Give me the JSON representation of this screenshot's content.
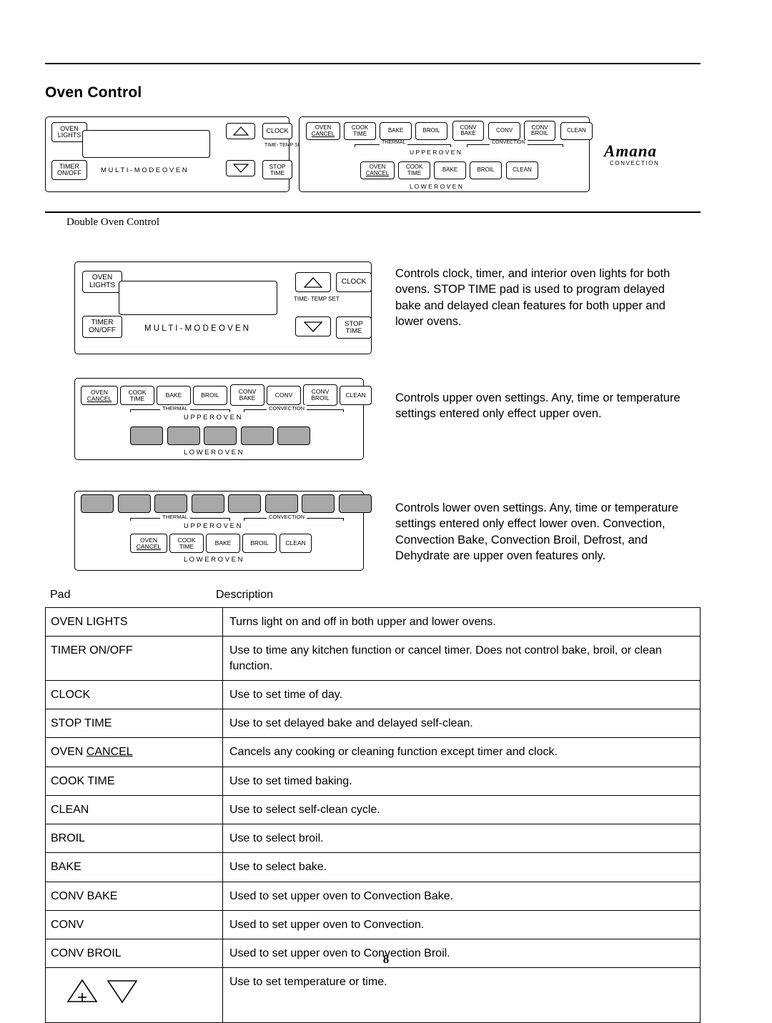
{
  "document": {
    "title": "Oven Control",
    "page_number": "8",
    "figure_caption": "Double Oven Control"
  },
  "panel_labels": {
    "multi_mode_oven": "M U L T I - M O D E   O V E N",
    "thermal": "THERMAL",
    "convection": "CONVECTION",
    "upper_oven": "U P P E R   O V E N",
    "lower_oven": "L O W E R   O V E N",
    "time_temp_set_l1": "TIME-",
    "time_temp_set_l2": "TEMP",
    "time_temp_set_l3": "SET",
    "brand": "Amana",
    "brand_sub": "CONVECTION"
  },
  "keys": {
    "oven_lights_l1": "OVEN",
    "oven_lights_l2": "LIGHTS",
    "timer_l1": "TIMER",
    "timer_l2": "ON/OFF",
    "clock": "CLOCK",
    "stop_l1": "STOP",
    "stop_l2": "TIME",
    "oven_cancel_l1": "OVEN",
    "oven_cancel_l2": "CANCEL",
    "cook_time_l1": "COOK",
    "cook_time_l2": "TIME",
    "bake": "BAKE",
    "broil": "BROIL",
    "conv_bake_l1": "CONV",
    "conv_bake_l2": "BAKE",
    "conv": "CONV",
    "conv_broil_l1": "CONV",
    "conv_broil_l2": "BROIL",
    "clean": "CLEAN"
  },
  "descriptions": [
    "Controls clock, timer, and interior oven lights for both ovens. STOP TIME pad is used to program delayed bake and delayed clean features for both upper and lower ovens.",
    "Controls upper oven settings. Any, time or temperature settings entered only effect upper oven.",
    "Controls lower oven settings. Any, time or temperature settings entered only effect lower oven. Convection, Convection Bake, Convection Broil, Defrost, and Dehydrate are upper oven features only."
  ],
  "table": {
    "headers": {
      "pad": "Pad",
      "description": "Description"
    },
    "rows": [
      {
        "pad": "OVEN LIGHTS",
        "pad_underline": "",
        "description": "Turns light on and off in both upper and lower ovens."
      },
      {
        "pad": "TIMER ON/OFF",
        "pad_underline": "",
        "description": "Use to time any kitchen function or cancel timer. Does not control bake, broil, or clean function."
      },
      {
        "pad": "CLOCK",
        "pad_underline": "",
        "description": "Use to set time of day."
      },
      {
        "pad": "STOP TIME",
        "pad_underline": "",
        "description": "Use to set delayed bake and delayed self-clean."
      },
      {
        "pad": "OVEN ",
        "pad_underline": "CANCEL",
        "description": "Cancels any cooking or cleaning function except timer and clock."
      },
      {
        "pad": "COOK TIME",
        "pad_underline": "",
        "description": "Use to set timed baking."
      },
      {
        "pad": "CLEAN",
        "pad_underline": "",
        "description": "Use to select self-clean cycle."
      },
      {
        "pad": "BROIL",
        "pad_underline": "",
        "description": "Use to select broil."
      },
      {
        "pad": "BAKE",
        "pad_underline": "",
        "description": "Use to select bake."
      },
      {
        "pad": "CONV BAKE",
        "pad_underline": "",
        "description": "Used to set upper oven to Convection Bake."
      },
      {
        "pad": "CONV",
        "pad_underline": "",
        "description": "Used to set upper oven to Convection."
      },
      {
        "pad": "CONV BROIL",
        "pad_underline": "",
        "description": "Used to set upper oven to Convection Broil."
      },
      {
        "pad": "",
        "pad_underline": "",
        "description": "Use to set temperature or time."
      }
    ]
  }
}
